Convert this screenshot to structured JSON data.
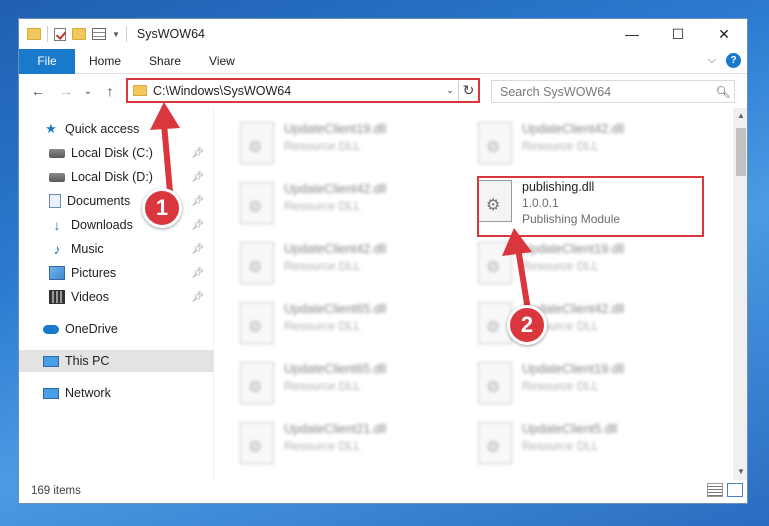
{
  "window": {
    "title": "SysWOW64",
    "controls": {
      "minimize": "—",
      "maximize": "☐",
      "close": "✕"
    }
  },
  "ribbon": {
    "file_tab": "File",
    "tabs": [
      "Home",
      "Share",
      "View"
    ],
    "collapse": "⌵",
    "help": "?"
  },
  "nav": {
    "back": "←",
    "forward": "→",
    "recent": "⌄",
    "up": "↑",
    "address": "C:\\Windows\\SysWOW64",
    "address_dropdown": "⌄",
    "refresh": "↻",
    "search_placeholder": "Search SysWOW64",
    "search_icon": "search-icon"
  },
  "sidebar": {
    "items": [
      {
        "label": "Quick access",
        "icon": "star-icon",
        "pinned": false
      },
      {
        "label": "Local Disk (C:)",
        "icon": "disk-icon",
        "pinned": true
      },
      {
        "label": "Local Disk (D:)",
        "icon": "disk-icon",
        "pinned": true
      },
      {
        "label": "Documents",
        "icon": "document-icon",
        "pinned": true
      },
      {
        "label": "Downloads",
        "icon": "download-icon",
        "pinned": true
      },
      {
        "label": "Music",
        "icon": "music-icon",
        "pinned": true
      },
      {
        "label": "Pictures",
        "icon": "pictures-icon",
        "pinned": true
      },
      {
        "label": "Videos",
        "icon": "video-icon",
        "pinned": true
      },
      {
        "label": "OneDrive",
        "icon": "cloud-icon",
        "pinned": false
      },
      {
        "label": "This PC",
        "icon": "computer-icon",
        "pinned": false,
        "selected": true
      },
      {
        "label": "Network",
        "icon": "network-icon",
        "pinned": false
      }
    ],
    "pin_glyph": "📌"
  },
  "files": {
    "left_column": [
      {
        "name": "UpdateClient19.dll",
        "type": "Resource DLL"
      },
      {
        "name": "UpdateClient42.dll",
        "type": "Resource DLL"
      },
      {
        "name": "UpdateClient42.dll",
        "type": "Resource DLL"
      },
      {
        "name": "UpdateClient65.dll",
        "type": "Resource DLL"
      },
      {
        "name": "UpdateClient65.dll",
        "type": "Resource DLL"
      },
      {
        "name": "UpdateClient21.dll",
        "type": "Resource DLL"
      }
    ],
    "right_column": [
      {
        "name": "UpdateClient42.dll",
        "type": "Resource DLL"
      },
      {
        "name": "UpdateClient19.dll",
        "type": "Resource DLL"
      },
      {
        "name": "UpdateClient42.dll",
        "type": "Resource DLL"
      },
      {
        "name": "UpdateClient19.dll",
        "type": "Resource DLL"
      },
      {
        "name": "UpdateClient5.dll",
        "type": "Resource DLL"
      }
    ],
    "highlighted": {
      "name": "publishing.dll",
      "version": "1.0.0.1",
      "type": "Publishing Module"
    }
  },
  "status": {
    "item_count": "169 items"
  },
  "annotations": {
    "step1": "1",
    "step2": "2",
    "color": "#d9363e"
  },
  "colors": {
    "accent": "#1979ca",
    "annotation": "#d9363e"
  }
}
